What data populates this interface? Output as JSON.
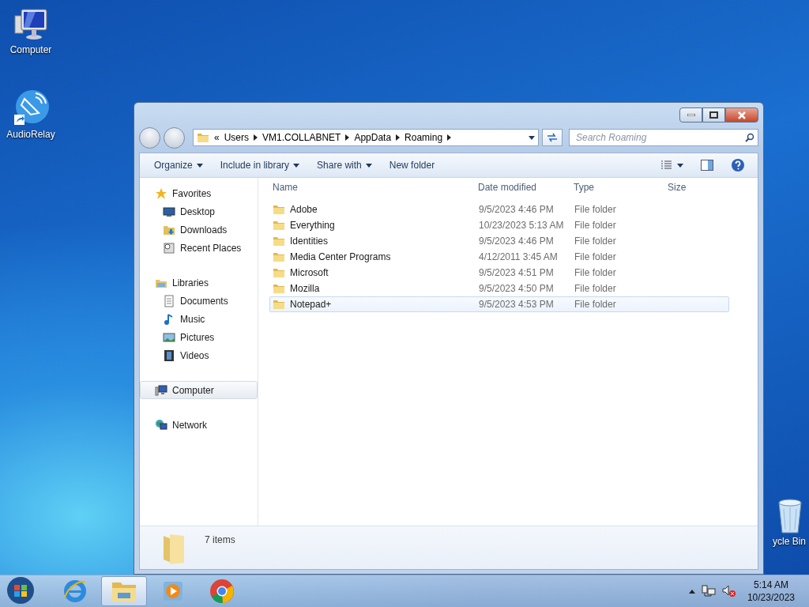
{
  "desktop_icons": [
    {
      "label": "Computer",
      "kind": "computer"
    },
    {
      "label": "AudioRelay",
      "kind": "audiorelay"
    },
    {
      "label": "ycle Bin",
      "kind": "recycle"
    }
  ],
  "window": {
    "breadcrumb": [
      "«",
      "Users",
      "VM1.COLLABNET",
      "AppData",
      "Roaming"
    ],
    "search": {
      "placeholder": "Search Roaming"
    },
    "toolbar": [
      {
        "label": "Organize",
        "dropdown": true
      },
      {
        "label": "Include in library",
        "dropdown": true
      },
      {
        "label": "Share with",
        "dropdown": true
      },
      {
        "label": "New folder",
        "dropdown": false
      }
    ],
    "nav": [
      {
        "label": "Favorites",
        "kind": "star",
        "selected": false,
        "children": [
          {
            "label": "Desktop",
            "kind": "desktop",
            "selected": false
          },
          {
            "label": "Downloads",
            "kind": "downloads",
            "selected": false
          },
          {
            "label": "Recent Places",
            "kind": "recent",
            "selected": false
          }
        ]
      },
      {
        "label": "Libraries",
        "kind": "libraries",
        "selected": false,
        "children": [
          {
            "label": "Documents",
            "kind": "documents",
            "selected": false
          },
          {
            "label": "Music",
            "kind": "music",
            "selected": false
          },
          {
            "label": "Pictures",
            "kind": "pictures",
            "selected": false
          },
          {
            "label": "Videos",
            "kind": "videos",
            "selected": false
          }
        ]
      },
      {
        "label": "Computer",
        "kind": "computer",
        "selected": true
      },
      {
        "label": "Network",
        "kind": "network",
        "selected": false
      }
    ],
    "columns": [
      "Name",
      "Date modified",
      "Type",
      "Size"
    ],
    "rows": [
      {
        "name": "Adobe",
        "date": "9/5/2023 4:46 PM",
        "type": "File folder",
        "selected": false
      },
      {
        "name": "Everything",
        "date": "10/23/2023 5:13 AM",
        "type": "File folder",
        "selected": false
      },
      {
        "name": "Identities",
        "date": "9/5/2023 4:46 PM",
        "type": "File folder",
        "selected": false
      },
      {
        "name": "Media Center Programs",
        "date": "4/12/2011 3:45 AM",
        "type": "File folder",
        "selected": false
      },
      {
        "name": "Microsoft",
        "date": "9/5/2023 4:51 PM",
        "type": "File folder",
        "selected": false
      },
      {
        "name": "Mozilla",
        "date": "9/5/2023 4:50 PM",
        "type": "File folder",
        "selected": false
      },
      {
        "name": "Notepad+",
        "date": "9/5/2023 4:53 PM",
        "type": "File folder",
        "selected": true
      }
    ],
    "status": "7 items"
  },
  "taskbar": {
    "apps": [
      {
        "kind": "ie",
        "active": false
      },
      {
        "kind": "explorer",
        "active": true
      },
      {
        "kind": "media",
        "active": false
      },
      {
        "kind": "chrome",
        "active": false
      }
    ],
    "clock": {
      "time": "5:14 AM",
      "date": "10/23/2023"
    }
  }
}
